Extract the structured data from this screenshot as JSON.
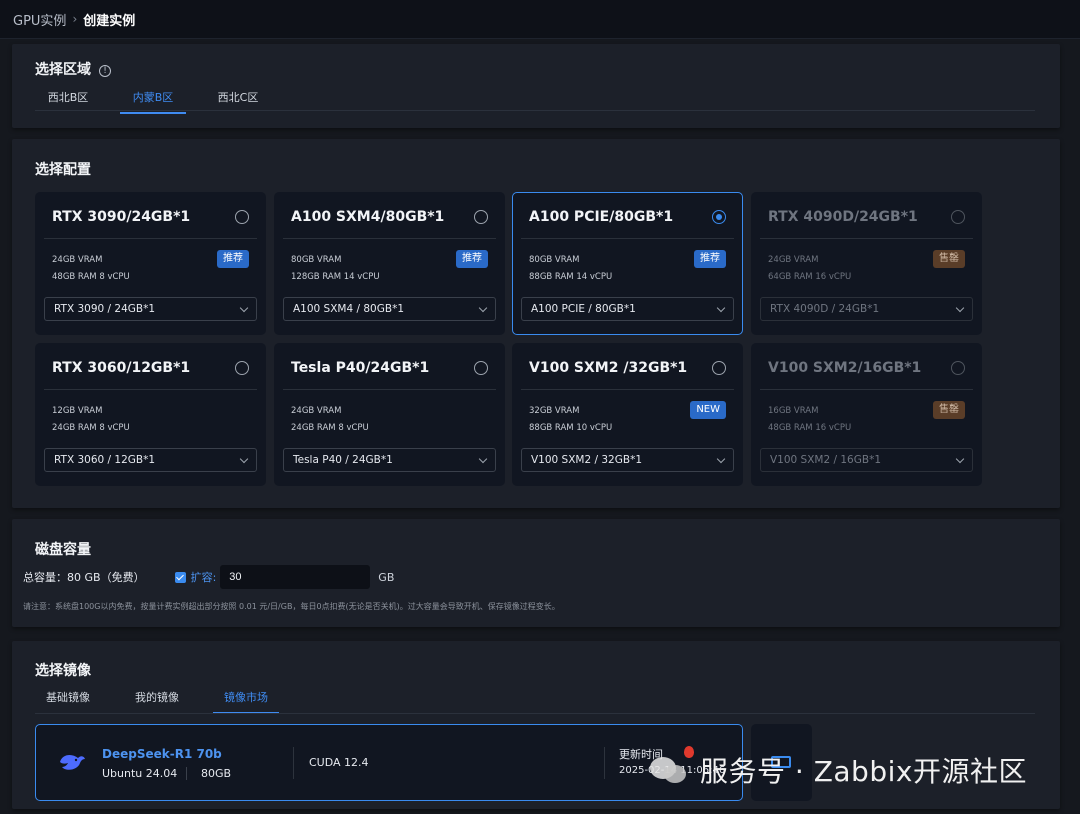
{
  "breadcrumb": {
    "root": "GPU实例",
    "separator": "›",
    "current": "创建实例"
  },
  "region": {
    "title": "选择区域",
    "info_icon": "info-icon",
    "tabs": [
      {
        "label": "西北B区",
        "active": false
      },
      {
        "label": "内蒙B区",
        "active": true
      },
      {
        "label": "西北C区",
        "active": false
      }
    ]
  },
  "config": {
    "title": "选择配置",
    "cards": [
      {
        "name": "RTX 3090/24GB*1",
        "vram": "24GB VRAM",
        "ram": "48GB RAM 8 vCPU",
        "badge": "推荐",
        "select": "RTX 3090 / 24GB*1",
        "selected": false,
        "disabled": false
      },
      {
        "name": "A100 SXM4/80GB*1",
        "vram": "80GB VRAM",
        "ram": "128GB RAM 14 vCPU",
        "badge": "推荐",
        "select": "A100 SXM4 / 80GB*1",
        "selected": false,
        "disabled": false
      },
      {
        "name": "A100 PCIE/80GB*1",
        "vram": "80GB VRAM",
        "ram": "88GB RAM 14 vCPU",
        "badge": "推荐",
        "select": "A100 PCIE / 80GB*1",
        "selected": true,
        "disabled": false
      },
      {
        "name": "RTX 4090D/24GB*1",
        "vram": "24GB VRAM",
        "ram": "64GB RAM 16 vCPU",
        "badge": "售罄",
        "select": "RTX 4090D / 24GB*1",
        "selected": false,
        "disabled": true
      },
      {
        "name": "RTX 3060/12GB*1",
        "vram": "12GB VRAM",
        "ram": "24GB RAM 8 vCPU",
        "badge": "",
        "select": "RTX 3060 / 12GB*1",
        "selected": false,
        "disabled": false
      },
      {
        "name": "Tesla P40/24GB*1",
        "vram": "24GB VRAM",
        "ram": "24GB RAM 8 vCPU",
        "badge": "",
        "select": "Tesla P40 / 24GB*1",
        "selected": false,
        "disabled": false
      },
      {
        "name": "V100 SXM2 /32GB*1",
        "vram": "32GB VRAM",
        "ram": "88GB RAM 10 vCPU",
        "badge": "NEW",
        "select": "V100 SXM2 / 32GB*1",
        "selected": false,
        "disabled": false
      },
      {
        "name": "V100 SXM2/16GB*1",
        "vram": "16GB VRAM",
        "ram": "48GB RAM 16 vCPU",
        "badge": "售罄",
        "select": "V100 SXM2 / 16GB*1",
        "selected": false,
        "disabled": true
      }
    ]
  },
  "disk": {
    "title": "磁盘容量",
    "total": "总容量：80 GB（免费）",
    "expand_checked": true,
    "expand_label": "扩容:",
    "value": "30",
    "unit": "GB",
    "note": "请注意：系统盘100G以内免费，按量计费实例超出部分按照 0.01 元/日/GB，每日0点扣费(无论是否关机)。过大容量会导致开机、保存镜像过程变长。"
  },
  "image": {
    "title": "选择镜像",
    "tabs": [
      {
        "label": "基础镜像",
        "active": false
      },
      {
        "label": "我的镜像",
        "active": false
      },
      {
        "label": "镜像市场",
        "active": true
      }
    ],
    "selected": {
      "logo": "deepseek-whale-icon",
      "name": "DeepSeek-R1 70b",
      "os": "Ubuntu 24.04",
      "size": "80GB",
      "cuda": "CUDA 12.4",
      "update_label": "更新时间",
      "update_value": "2025-02-14 11:06:46",
      "hot_icon": "fire-icon"
    }
  },
  "watermark": {
    "text": "服务号 · Zabbix开源社区",
    "icon": "wechat-icon"
  }
}
